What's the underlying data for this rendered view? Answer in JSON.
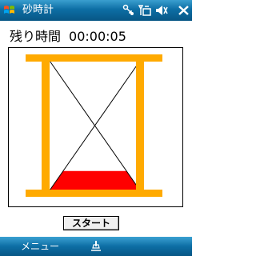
{
  "window": {
    "title": "砂時計",
    "close_label": "ok"
  },
  "main": {
    "elapsed_label": "残り時間",
    "elapsed_time": "00:00:05",
    "start_button_label": "スタート"
  },
  "hourglass": {
    "sand_level": 0.3,
    "frame_color": "#ffaa00",
    "sand_color": "#ff0000"
  },
  "softkeys": {
    "left_label": "メニュー"
  },
  "icons": {
    "start": "windows-flag-icon",
    "connectivity": "connectivity-icon",
    "signal": "signal-icon",
    "volume": "volume-icon",
    "keyboard": "keyboard-icon"
  },
  "colors": {
    "titlebar": "#0d6ea4",
    "softkey_bar": "#0d6ea4"
  }
}
